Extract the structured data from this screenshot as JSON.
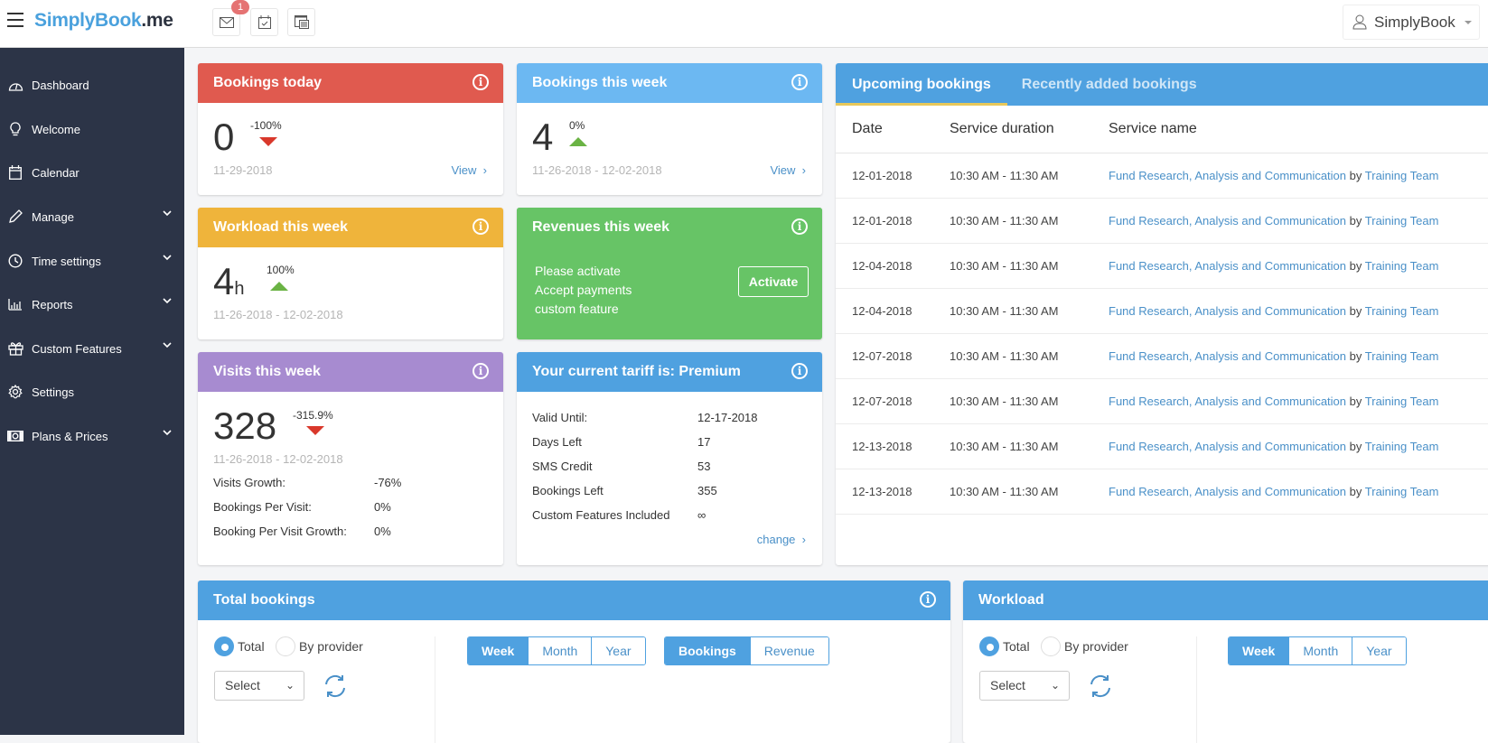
{
  "topbar": {
    "logo_main": "SimplyBook",
    "logo_suffix": ".me",
    "notification_count": "1",
    "user_name": "SimplyBook",
    "icons": [
      "menu-icon",
      "mail-icon",
      "calendar-check-icon",
      "report-icon",
      "user-icon"
    ]
  },
  "sidebar": {
    "items": [
      {
        "label": "Dashboard",
        "icon": "dashboard-icon",
        "expandable": false
      },
      {
        "label": "Welcome",
        "icon": "lightbulb-icon",
        "expandable": false
      },
      {
        "label": "Calendar",
        "icon": "calendar-icon",
        "expandable": false
      },
      {
        "label": "Manage",
        "icon": "pencil-icon",
        "expandable": true
      },
      {
        "label": "Time settings",
        "icon": "clock-icon",
        "expandable": true
      },
      {
        "label": "Reports",
        "icon": "bar-chart-icon",
        "expandable": true
      },
      {
        "label": "Custom Features",
        "icon": "gift-icon",
        "expandable": true
      },
      {
        "label": "Settings",
        "icon": "gear-icon",
        "expandable": false
      },
      {
        "label": "Plans & Prices",
        "icon": "money-icon",
        "expandable": true
      }
    ]
  },
  "cards": {
    "bookings_today": {
      "title": "Bookings today",
      "value": "0",
      "change": "-100%",
      "trend": "down",
      "date": "11-29-2018",
      "link": "View",
      "color": "#e05a4f"
    },
    "bookings_week": {
      "title": "Bookings this week",
      "value": "4",
      "change": "0%",
      "trend": "up",
      "date": "11-26-2018 - 12-02-2018",
      "link": "View",
      "color": "#6cb8f2"
    },
    "workload_week": {
      "title": "Workload this week",
      "value": "4",
      "unit": "h",
      "change": "100%",
      "trend": "up",
      "date": "11-26-2018 - 12-02-2018",
      "color": "#efb43b"
    },
    "revenues_week": {
      "title": "Revenues this week",
      "lines": [
        "Please activate",
        "Accept payments",
        "custom feature"
      ],
      "button": "Activate",
      "color": "#67c466"
    },
    "visits_week": {
      "title": "Visits this week",
      "value": "328",
      "change": "-315.9%",
      "trend": "down",
      "date": "11-26-2018 - 12-02-2018",
      "color": "#a78bd0",
      "stats": [
        {
          "label": "Visits Growth:",
          "value": "-76%"
        },
        {
          "label": "Bookings Per Visit:",
          "value": "0%"
        },
        {
          "label": "Booking Per Visit Growth:",
          "value": "0%"
        }
      ]
    },
    "tariff": {
      "title": "Your current tariff is: Premium",
      "color": "#4fa1e0",
      "rows": [
        {
          "label": "Valid Until:",
          "value": "12-17-2018"
        },
        {
          "label": "Days Left",
          "value": "17"
        },
        {
          "label": "SMS Credit",
          "value": "53"
        },
        {
          "label": "Bookings Left",
          "value": "355"
        },
        {
          "label": "Custom Features Included",
          "value": "∞"
        }
      ],
      "link": "change"
    }
  },
  "bookings_panel": {
    "tabs": [
      {
        "label": "Upcoming bookings",
        "active": true
      },
      {
        "label": "Recently added bookings",
        "active": false
      }
    ],
    "columns": [
      "Date",
      "Service duration",
      "Service name"
    ],
    "rows": [
      {
        "date": "12-01-2018",
        "duration": "10:30 AM - 11:30 AM",
        "service": "Fund Research, Analysis and Communication",
        "by": "by",
        "provider": "Training Team"
      },
      {
        "date": "12-01-2018",
        "duration": "10:30 AM - 11:30 AM",
        "service": "Fund Research, Analysis and Communication",
        "by": "by",
        "provider": "Training Team"
      },
      {
        "date": "12-04-2018",
        "duration": "10:30 AM - 11:30 AM",
        "service": "Fund Research, Analysis and Communication",
        "by": "by",
        "provider": "Training Team"
      },
      {
        "date": "12-04-2018",
        "duration": "10:30 AM - 11:30 AM",
        "service": "Fund Research, Analysis and Communication",
        "by": "by",
        "provider": "Training Team"
      },
      {
        "date": "12-07-2018",
        "duration": "10:30 AM - 11:30 AM",
        "service": "Fund Research, Analysis and Communication",
        "by": "by",
        "provider": "Training Team"
      },
      {
        "date": "12-07-2018",
        "duration": "10:30 AM - 11:30 AM",
        "service": "Fund Research, Analysis and Communication",
        "by": "by",
        "provider": "Training Team"
      },
      {
        "date": "12-13-2018",
        "duration": "10:30 AM - 11:30 AM",
        "service": "Fund Research, Analysis and Communication",
        "by": "by",
        "provider": "Training Team"
      },
      {
        "date": "12-13-2018",
        "duration": "10:30 AM - 11:30 AM",
        "service": "Fund Research, Analysis and Communication",
        "by": "by",
        "provider": "Training Team"
      }
    ]
  },
  "total_bookings": {
    "title": "Total bookings",
    "radios": [
      {
        "label": "Total",
        "checked": true
      },
      {
        "label": "By provider",
        "checked": false
      }
    ],
    "select_value": "Select",
    "period_buttons": [
      {
        "label": "Week",
        "active": true
      },
      {
        "label": "Month",
        "active": false
      },
      {
        "label": "Year",
        "active": false
      }
    ],
    "metric_buttons": [
      {
        "label": "Bookings",
        "active": true
      },
      {
        "label": "Revenue",
        "active": false
      }
    ]
  },
  "workload": {
    "title": "Workload",
    "radios": [
      {
        "label": "Total",
        "checked": true
      },
      {
        "label": "By provider",
        "checked": false
      }
    ],
    "select_value": "Select",
    "period_buttons": [
      {
        "label": "Week",
        "active": true
      },
      {
        "label": "Month",
        "active": false
      },
      {
        "label": "Year",
        "active": false
      }
    ]
  }
}
